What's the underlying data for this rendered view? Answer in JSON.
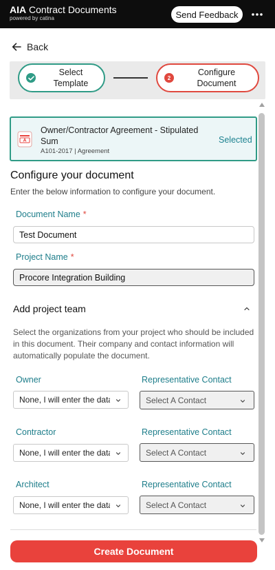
{
  "header": {
    "brand_strong": "AIA",
    "brand_rest": " Contract Documents",
    "powered_by": "powered by catina",
    "feedback_label": "Send Feedback",
    "more_icon": "more-horizontal-icon"
  },
  "nav": {
    "back_label": "Back"
  },
  "stepper": {
    "steps": [
      {
        "label": "Select Template",
        "state": "complete",
        "icon": "check-circle-icon"
      },
      {
        "label": "Configure Document",
        "state": "current",
        "number": "2"
      }
    ]
  },
  "template": {
    "title": "Owner/Contractor Agreement - Stipulated Sum",
    "subtitle": "A101-2017 | Agreement",
    "status": "Selected",
    "icon": "document-icon"
  },
  "configure": {
    "title": "Configure your document",
    "description": "Enter the below information to configure your document.",
    "document_name_label": "Document Name",
    "document_name_value": "Test Document",
    "project_name_label": "Project Name",
    "project_name_value": "Procore Integration Building",
    "required_mark": "*"
  },
  "team": {
    "title": "Add project team",
    "description": "Select the organizations from your project who should be included in this document. Their company and contact information will automatically populate the document.",
    "rep_label": "Representative Contact",
    "rows": [
      {
        "role": "Owner",
        "org_value": "None, I will enter the data",
        "contact_value": "Select A Contact"
      },
      {
        "role": "Contractor",
        "org_value": "None, I will enter the data",
        "contact_value": "Select A Contact"
      },
      {
        "role": "Architect",
        "org_value": "None, I will enter the data",
        "contact_value": "Select A Contact"
      }
    ]
  },
  "actions": {
    "create_label": "Create Document"
  },
  "colors": {
    "accent_teal": "#2f9b86",
    "accent_red": "#e9423c",
    "label_teal": "#1d7d8a",
    "topbar": "#0d0d0d"
  }
}
